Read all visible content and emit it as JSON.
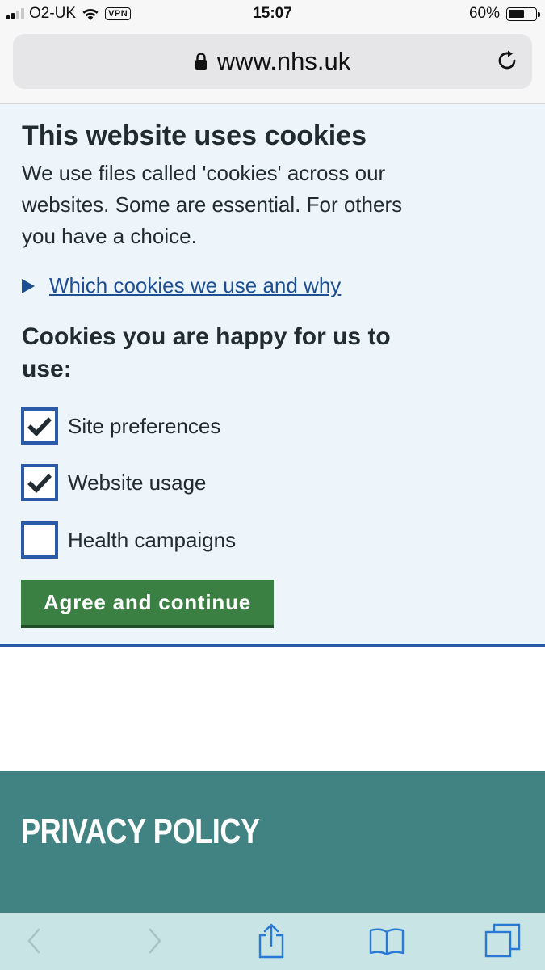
{
  "status_bar": {
    "carrier": "O2-UK",
    "vpn_label": "VPN",
    "time": "15:07",
    "battery_percent": "60%",
    "battery_level": 0.6
  },
  "browser": {
    "url": "www.nhs.uk"
  },
  "cookie_banner": {
    "title": "This website uses cookies",
    "description": "We use files called 'cookies' across our websites. Some are essential. For others you have a choice.",
    "details_link": "Which cookies we use and why",
    "subtitle": "Cookies you are happy for us to use:",
    "options": [
      {
        "label": "Site preferences",
        "checked": true
      },
      {
        "label": "Website usage",
        "checked": true
      },
      {
        "label": "Health campaigns",
        "checked": false
      }
    ],
    "agree_button": "Agree and continue"
  },
  "privacy": {
    "title": "PRIVACY POLICY"
  },
  "colors": {
    "banner_bg": "#edf5fb",
    "link_blue": "#1d4e92",
    "checkbox_border": "#2a5aa8",
    "button_green": "#3a8042",
    "privacy_teal": "#418382",
    "toolbar_bg": "#c8e4e5",
    "toolbar_icon_blue": "#2b79d6"
  },
  "toolbar": {
    "icons": [
      "back-icon",
      "forward-icon",
      "share-icon",
      "bookmarks-icon",
      "tabs-icon"
    ]
  }
}
